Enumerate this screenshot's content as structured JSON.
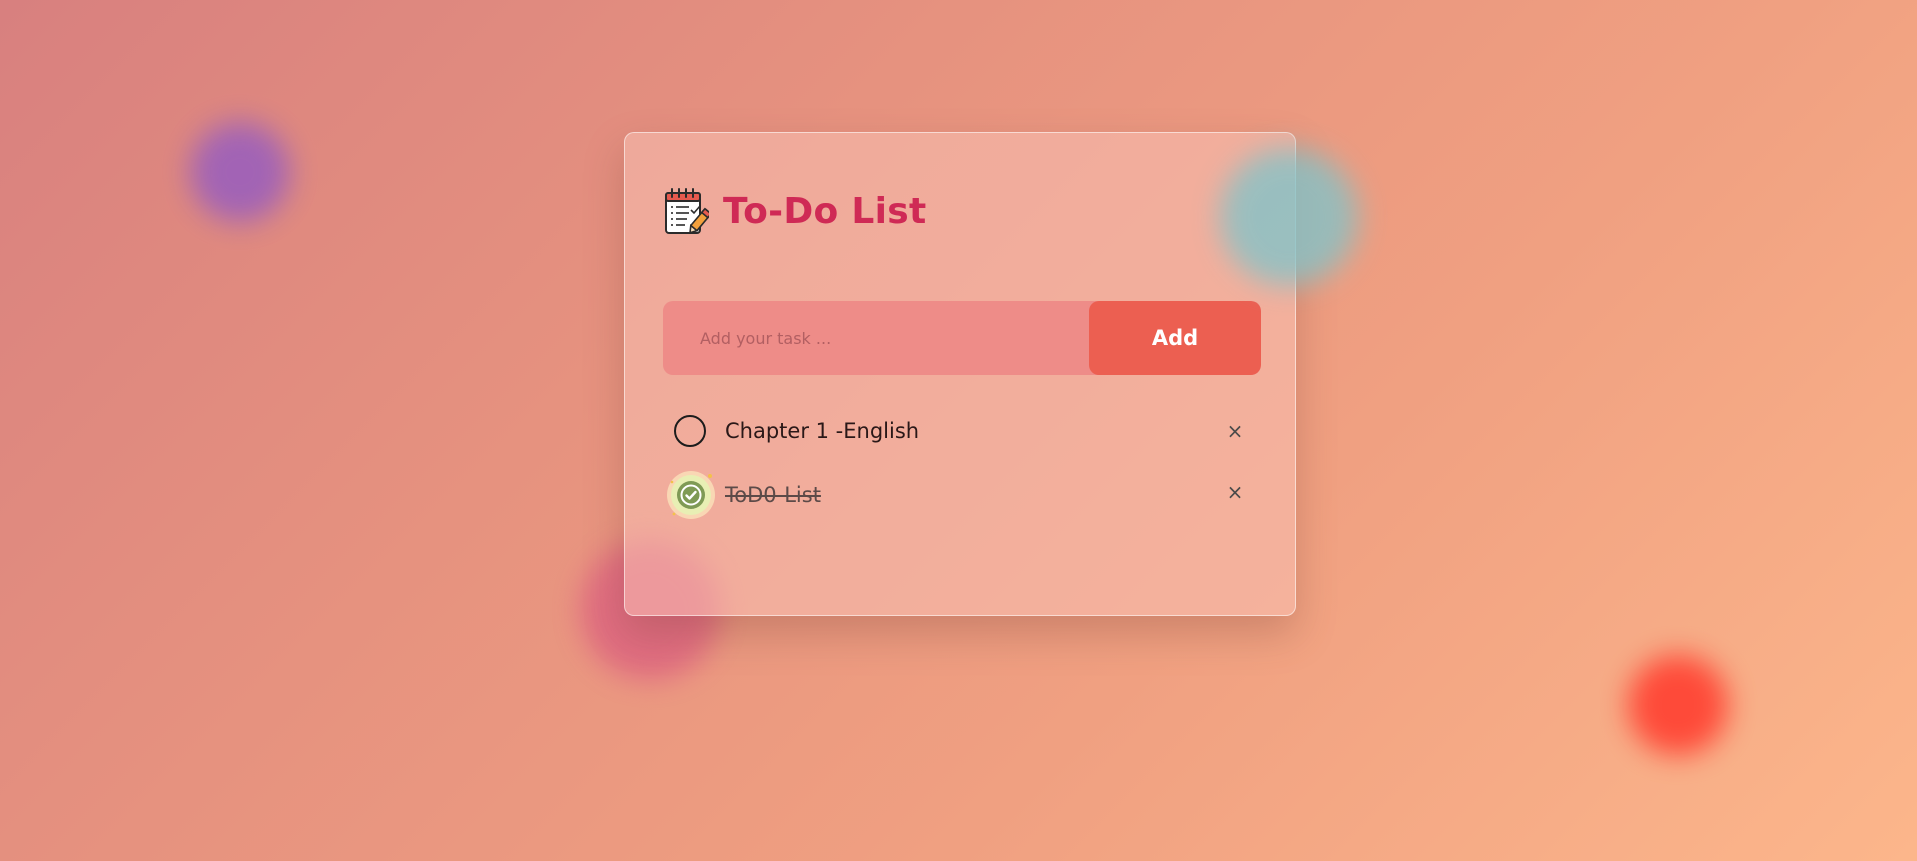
{
  "app": {
    "title": "To-Do List",
    "title_icon": "notepad-pencil-icon"
  },
  "input": {
    "placeholder": "Add your task ...",
    "value": ""
  },
  "add_button": {
    "label": "Add"
  },
  "tasks": [
    {
      "text": "Chapter 1 -English",
      "completed": false,
      "check_icon": "empty-circle-icon",
      "delete_label": "×"
    },
    {
      "text": "ToD0-List",
      "completed": true,
      "check_icon": "checkmark-badge-icon",
      "delete_label": "×"
    }
  ],
  "colors": {
    "title": "#cf2a55",
    "add_button_bg": "#ec5f51",
    "input_bg": "#ee8c88",
    "background_start": "#d8807f",
    "background_end": "#fcb68b"
  }
}
